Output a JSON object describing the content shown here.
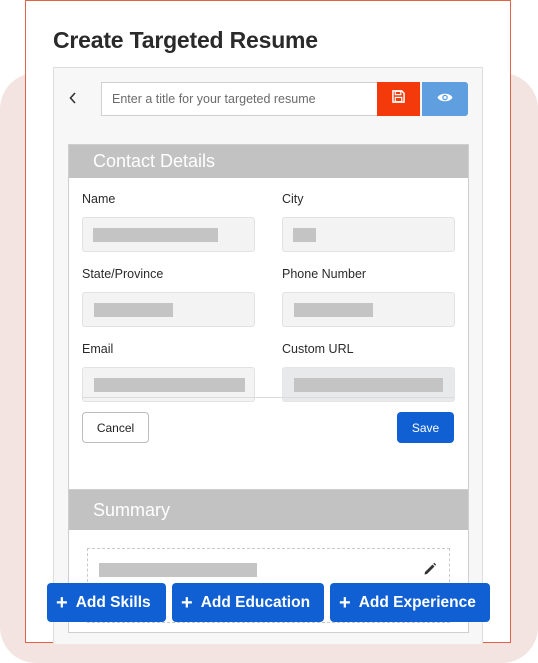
{
  "page": {
    "title": "Create Targeted Resume"
  },
  "toolbar": {
    "back_icon": "chevron-left-icon",
    "back_glyph": "‹",
    "title_input": {
      "value": "",
      "placeholder": "Enter a title for your targeted resume"
    },
    "save_icon": "floppy-disk-icon",
    "preview_icon": "eye-icon"
  },
  "colors": {
    "accent_blue": "#1060d3",
    "save_red": "#f43a0a",
    "preview_blue": "#5f9fe0",
    "frame_border": "#e2634a",
    "background_shape": "#f4e4e1",
    "section_header": "#c2c2c2"
  },
  "contact": {
    "heading": "Contact Details",
    "fields": [
      {
        "label": "Name",
        "value": "[redacted]",
        "readonly": false
      },
      {
        "label": "City",
        "value": "[redacted]",
        "readonly": false
      },
      {
        "label": "State/Province",
        "value": "[redacted]",
        "readonly": false
      },
      {
        "label": "Phone Number",
        "value": "[redacted]",
        "readonly": false
      },
      {
        "label": "Email",
        "value": "[redacted]",
        "readonly": false
      },
      {
        "label": "Custom URL",
        "value": "[redacted]",
        "readonly": true
      }
    ],
    "cancel_label": "Cancel",
    "save_label": "Save"
  },
  "summary": {
    "heading": "Summary",
    "text": "[redacted]",
    "edit_icon": "pencil-icon"
  },
  "actions": [
    {
      "label": "Add Skills",
      "icon": "plus-icon"
    },
    {
      "label": "Add Education",
      "icon": "plus-icon"
    },
    {
      "label": "Add Experience",
      "icon": "plus-icon"
    }
  ],
  "plus_glyph": "+"
}
